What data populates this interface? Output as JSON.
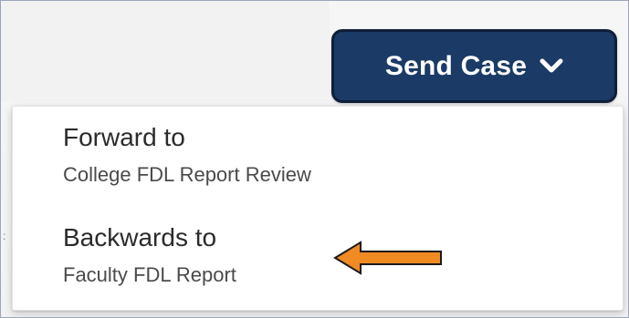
{
  "send_case": {
    "label": "Send Case",
    "icon": "chevron-down-icon",
    "bg_color": "#1b3a66",
    "border_color": "#0f1f3a"
  },
  "menu": {
    "items": [
      {
        "title": "Forward to",
        "subtitle": "College FDL Report Review"
      },
      {
        "title": "Backwards to",
        "subtitle": "Faculty FDL Report"
      }
    ]
  },
  "annotation": {
    "icon": "arrow-left-icon",
    "fill_color": "#f08a22",
    "stroke_color": "#1a1a1a"
  }
}
